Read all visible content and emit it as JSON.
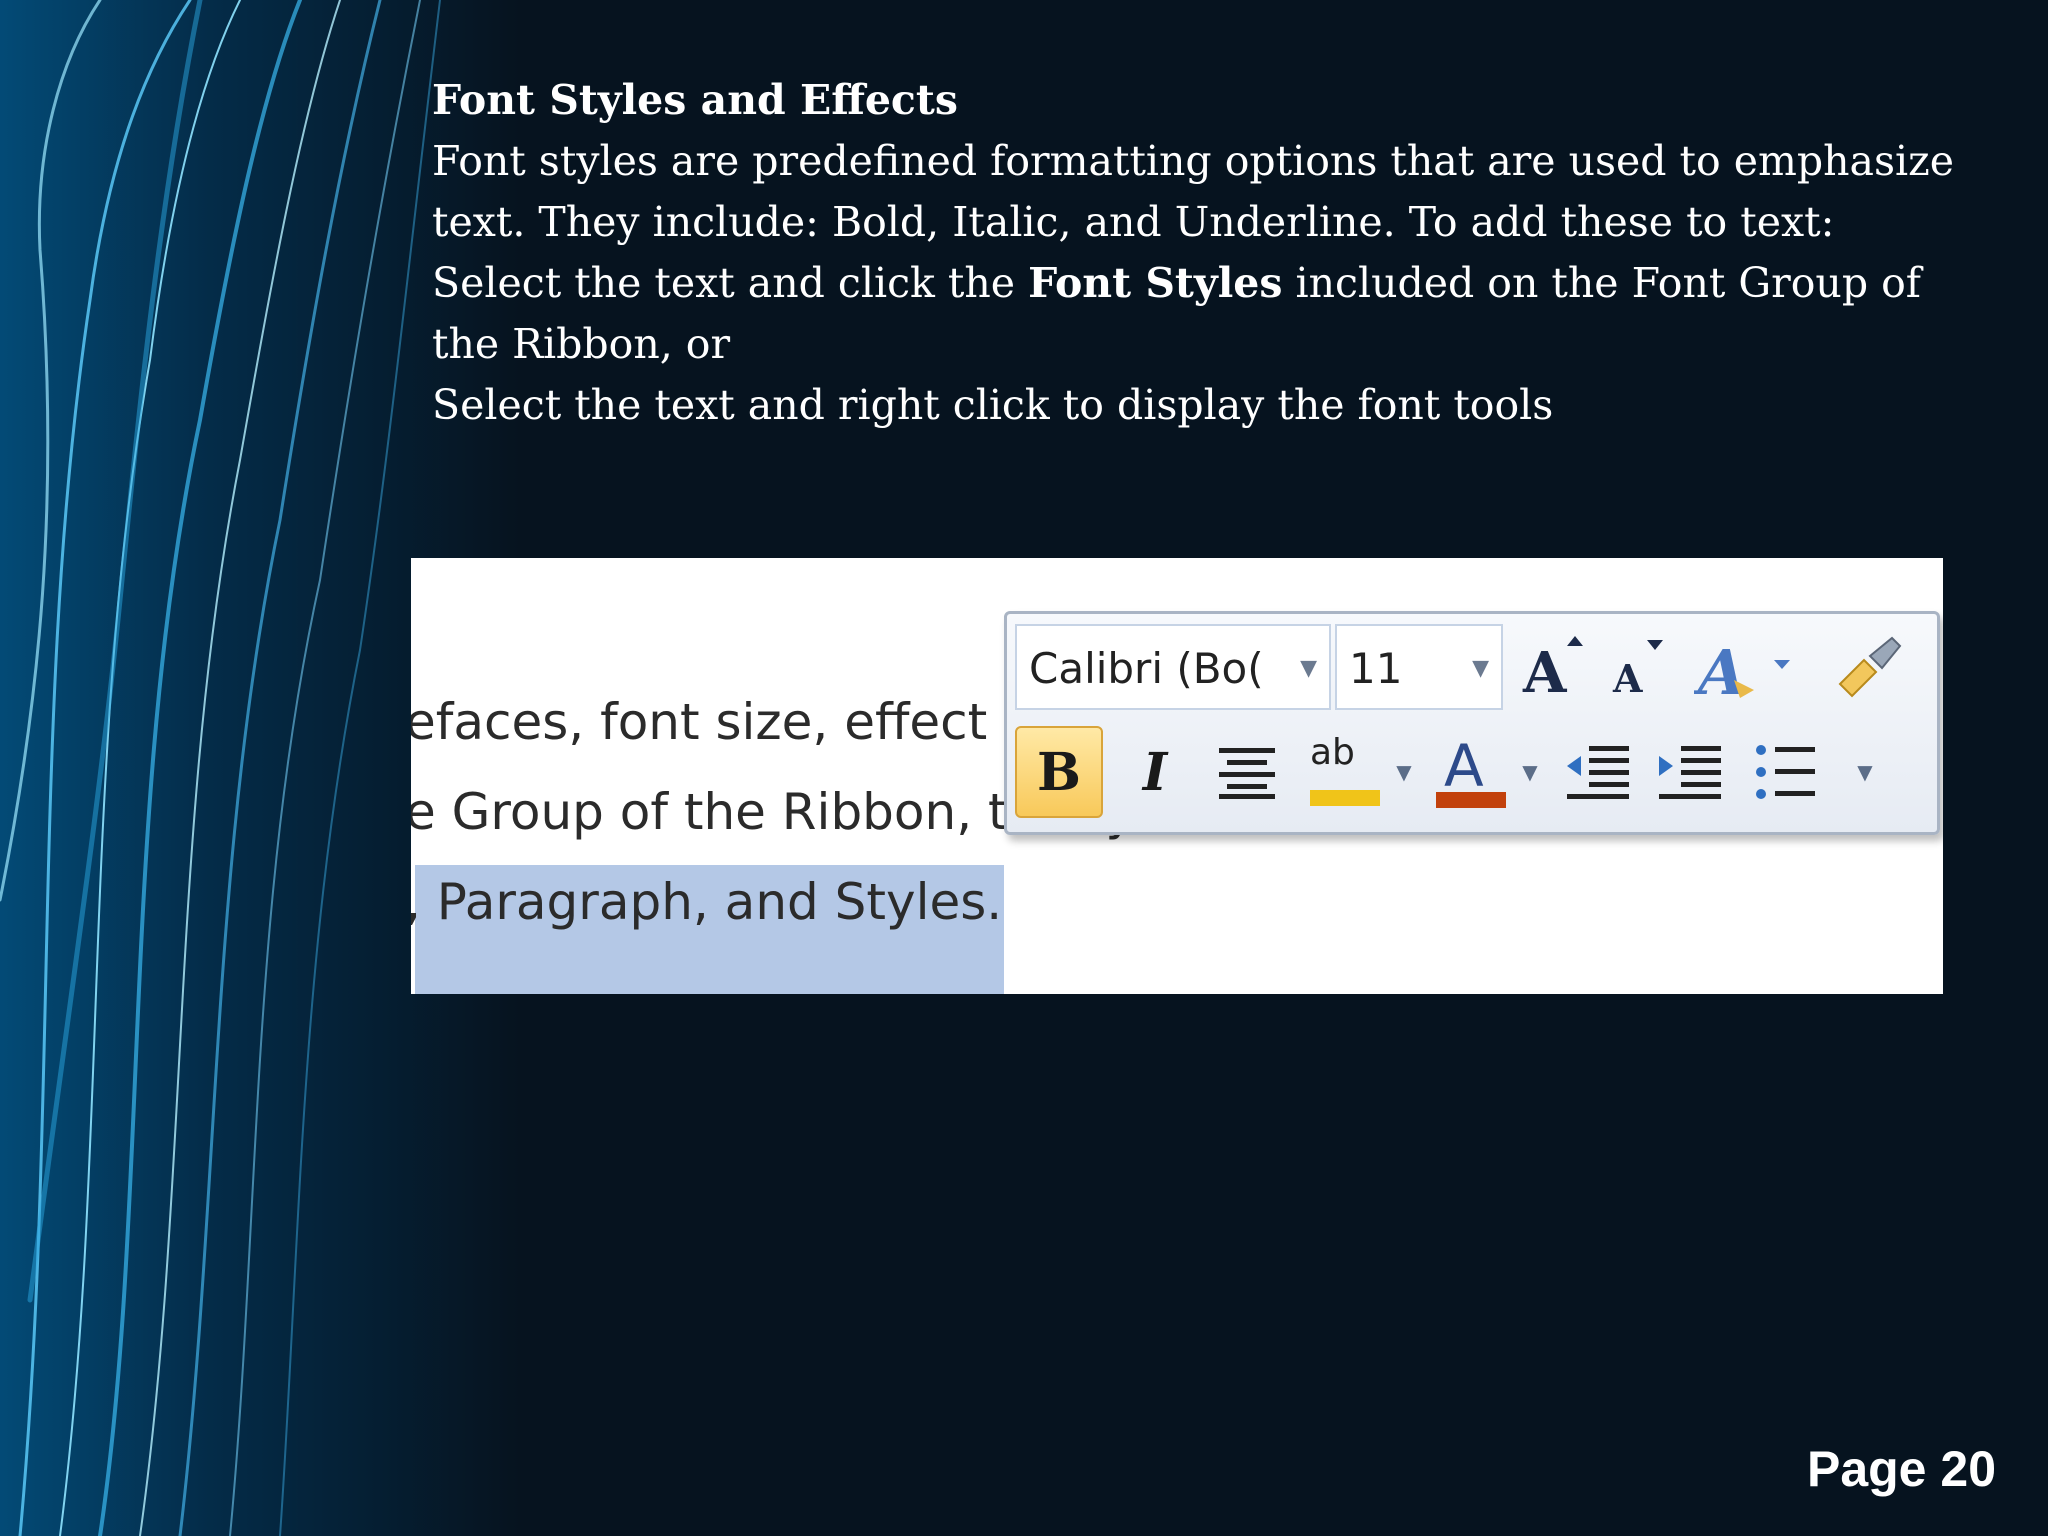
{
  "heading": "Font Styles and Effects",
  "paragraph1": "Font styles are predefined formatting options that are used to emphasize text. They include: Bold, Italic, and Underline. To add these to text:",
  "paragraph2": {
    "before": "Select the text and click the ",
    "bold": "Font Styles",
    "after": " included on the Font Group of the Ribbon, or"
  },
  "paragraph3": "Select the text and right click to display the font tools",
  "screenshot": {
    "doc_lines": [
      "efaces, font size, effect",
      "e Group of the Ribbon, that you have selected.",
      ", Paragraph, and Styles."
    ],
    "mini_toolbar": {
      "font_name": "Calibri (Bo(",
      "font_size": "11",
      "buttons": [
        "grow-font",
        "shrink-font",
        "styles",
        "format-painter",
        "bold",
        "italic",
        "center",
        "highlight",
        "font-color",
        "decrease-indent",
        "increase-indent",
        "bullets"
      ],
      "bold_label": "B",
      "italic_label": "I",
      "highlight_label": "ab",
      "highlight_color": "#f0c419",
      "font_color": "#c2410c"
    }
  },
  "page": "Page 20"
}
